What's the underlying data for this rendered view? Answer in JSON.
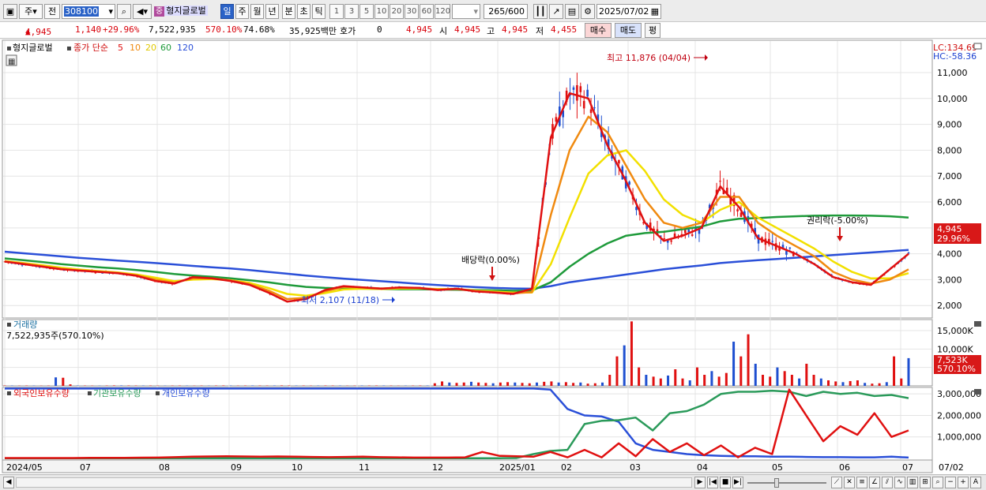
{
  "toolbar": {
    "menu_label": "주",
    "prev_label": "전",
    "stock_code": "308100",
    "stock_badge": "중",
    "stock_name": "형지글로벌",
    "periods": [
      "일",
      "주",
      "월",
      "년",
      "분",
      "초",
      "틱"
    ],
    "active_period": "일",
    "intervals": [
      "1",
      "3",
      "5",
      "10",
      "20",
      "30",
      "60",
      "120"
    ],
    "count_value": "265",
    "count_max": "/600",
    "date_value": "2025/07/02"
  },
  "quote": {
    "price": "4,945",
    "change": "1,140",
    "change_pct": "+29.96%",
    "volume": "7,522,935",
    "volume_ratio": "570.10%",
    "turnover": "74.68%",
    "amount": "35,925백만",
    "hoga_label": "호가",
    "hoga_value": "0",
    "close_value": "4,945",
    "open_label": "시",
    "open_value": "4,945",
    "high_label": "고",
    "high_value": "4,945",
    "low_label": "저",
    "low_value": "4,455",
    "buy_label": "매수",
    "sell_label": "매도",
    "avg_label": "평"
  },
  "legend": {
    "name": "형지글로벌",
    "ma_title": "종가 단순",
    "ma_periods": [
      "5",
      "10",
      "20",
      "60",
      "120"
    ],
    "lc": "LC:134.69",
    "hc": "HC:-58.36",
    "volume_title": "거래량",
    "volume_value": "7,522,935주(570.10%)",
    "holdings": [
      "외국인보유수량",
      "기관보유수량",
      "개인보유수량"
    ]
  },
  "annotations": {
    "high": "최고 11,876 (04/04)",
    "low": "최저 2,107 (11/18)",
    "dividend": "배당락(0.00%)",
    "rights": "권리락(-5.00%)",
    "price_tag": "4,945",
    "price_pct_tag": "29.96%",
    "vol_tag": "7,523K",
    "vol_pct_tag": "570.10%"
  },
  "colors": {
    "ma5": "#e01010",
    "ma10": "#f08a10",
    "ma20": "#f2e000",
    "ma60": "#1e9a3a",
    "ma120": "#2a4fd8",
    "up": "#e01010",
    "down": "#1e4fd0",
    "foreign": "#e01010",
    "institution": "#2a9a5a",
    "individual": "#2a4fd8"
  },
  "chart_data": [
    {
      "type": "candlestick",
      "title": "형지글로벌",
      "y_ticks": [
        "11,000",
        "10,000",
        "9,000",
        "8,000",
        "7,000",
        "6,000",
        "5,000",
        "4,000",
        "3,000",
        "2,000"
      ],
      "ylim": [
        1550,
        12250
      ],
      "x_ticks": [
        "2024/05",
        "07",
        "08",
        "09",
        "10",
        "11",
        "12",
        "2025/01",
        "02",
        "03",
        "04",
        "05",
        "06",
        "07",
        "07/02"
      ],
      "series": [
        {
          "name": "5",
          "values": [
            3700,
            3600,
            3500,
            3400,
            3350,
            3300,
            3250,
            3150,
            2950,
            2850,
            3100,
            3050,
            2950,
            2800,
            2500,
            2150,
            2250,
            2600,
            2750,
            2700,
            2650,
            2700,
            2680,
            2600,
            2650,
            2550,
            2500,
            2450,
            2650,
            8500,
            10200,
            10000,
            8200,
            6800,
            5200,
            4500,
            4700,
            5000,
            6600,
            5800,
            4600,
            4300,
            4000,
            3600,
            3100,
            2900,
            2800,
            3400,
            4000
          ]
        },
        {
          "name": "10",
          "values": [
            3700,
            3620,
            3520,
            3420,
            3360,
            3310,
            3260,
            3170,
            3000,
            2880,
            3050,
            3050,
            2970,
            2830,
            2580,
            2250,
            2300,
            2550,
            2720,
            2700,
            2660,
            2690,
            2680,
            2620,
            2640,
            2560,
            2510,
            2470,
            2520,
            5500,
            8000,
            9300,
            8700,
            7400,
            6100,
            5200,
            5000,
            5200,
            6200,
            6200,
            5200,
            4700,
            4300,
            3900,
            3300,
            3000,
            2850,
            3000,
            3400
          ]
        },
        {
          "name": "20",
          "values": [
            3720,
            3640,
            3560,
            3460,
            3390,
            3330,
            3280,
            3200,
            3080,
            2940,
            3000,
            3020,
            2980,
            2880,
            2680,
            2450,
            2380,
            2480,
            2620,
            2650,
            2640,
            2660,
            2660,
            2640,
            2640,
            2580,
            2540,
            2500,
            2500,
            3600,
            5400,
            7100,
            7800,
            8000,
            7200,
            6100,
            5500,
            5200,
            5700,
            6000,
            5400,
            5000,
            4600,
            4200,
            3700,
            3300,
            3050,
            3050,
            3250
          ]
        },
        {
          "name": "60",
          "values": [
            3820,
            3750,
            3680,
            3600,
            3540,
            3480,
            3430,
            3370,
            3300,
            3220,
            3160,
            3110,
            3050,
            2980,
            2900,
            2800,
            2720,
            2680,
            2660,
            2650,
            2640,
            2630,
            2630,
            2620,
            2610,
            2600,
            2590,
            2570,
            2580,
            2900,
            3500,
            4000,
            4400,
            4700,
            4800,
            4850,
            4950,
            5050,
            5250,
            5350,
            5380,
            5420,
            5450,
            5470,
            5480,
            5480,
            5470,
            5450,
            5400
          ]
        },
        {
          "name": "120",
          "values": [
            4080,
            4020,
            3960,
            3900,
            3840,
            3790,
            3740,
            3690,
            3640,
            3590,
            3530,
            3480,
            3430,
            3370,
            3300,
            3230,
            3160,
            3100,
            3040,
            2990,
            2940,
            2890,
            2840,
            2790,
            2750,
            2710,
            2680,
            2660,
            2650,
            2750,
            2900,
            3000,
            3100,
            3200,
            3300,
            3400,
            3480,
            3550,
            3640,
            3700,
            3750,
            3800,
            3850,
            3900,
            3950,
            4000,
            4050,
            4100,
            4150
          ]
        }
      ]
    },
    {
      "type": "bar",
      "title": "거래량",
      "y_ticks": [
        "15,000K",
        "10,000K",
        "5,000K"
      ],
      "ylim": [
        0,
        18000
      ],
      "values": [
        100,
        80,
        60,
        90,
        70,
        60,
        80,
        2300,
        2200,
        400,
        90,
        80,
        70,
        60,
        90,
        120,
        110,
        100,
        90,
        80,
        90,
        70,
        60,
        80,
        90,
        70,
        60,
        80,
        60,
        90,
        110,
        80,
        70,
        90,
        100,
        90,
        80,
        90,
        120,
        100,
        80,
        90,
        70,
        80,
        100,
        90,
        80,
        60,
        70,
        90,
        80,
        100,
        90,
        80,
        60,
        70,
        80,
        100,
        90,
        700,
        1200,
        900,
        800,
        900,
        1100,
        900,
        800,
        700,
        900,
        1000,
        900,
        800,
        700,
        900,
        1100,
        1200,
        900,
        1000,
        800,
        900,
        600,
        700,
        900,
        3000,
        8000,
        11000,
        17500,
        5000,
        3000,
        2500,
        2000,
        2800,
        4500,
        2000,
        1500,
        5000,
        3000,
        4000,
        2500,
        3500,
        12000,
        8000,
        14000,
        6000,
        3000,
        2500,
        5000,
        4000,
        3000,
        2000,
        6000,
        3000,
        2000,
        1500,
        1200,
        1000,
        1300,
        1500,
        800,
        600,
        700,
        1000,
        8000,
        2000,
        7523
      ]
    },
    {
      "type": "line",
      "title": "보유수량",
      "y_ticks": [
        "3,000,000",
        "2,000,000",
        "1,000,000"
      ],
      "ylim": [
        0,
        3300000
      ],
      "series": [
        {
          "name": "외국인보유수량",
          "values": [
            20000,
            20000,
            20000,
            20000,
            20000,
            30000,
            30000,
            30000,
            35000,
            40000,
            60000,
            80000,
            90000,
            100000,
            90000,
            80000,
            90000,
            80000,
            70000,
            60000,
            70000,
            80000,
            60000,
            50000,
            40000,
            40000,
            40000,
            50000,
            300000,
            120000,
            100000,
            80000,
            300000,
            50000,
            400000,
            50000,
            700000,
            100000,
            900000,
            300000,
            700000,
            150000,
            600000,
            50000,
            500000,
            200000,
            3200000,
            2000000,
            800000,
            1500000,
            1100000,
            2100000,
            1000000,
            1300000
          ]
        },
        {
          "name": "기관보유수량",
          "values": [
            10000,
            10000,
            10000,
            10000,
            10000,
            10000,
            10000,
            10000,
            10000,
            10000,
            10000,
            10000,
            10000,
            10000,
            10000,
            10000,
            10000,
            10000,
            10000,
            10000,
            10000,
            10000,
            10000,
            10000,
            10000,
            10000,
            10000,
            10000,
            10000,
            10000,
            20000,
            200000,
            350000,
            400000,
            1600000,
            1750000,
            1780000,
            1900000,
            1300000,
            2100000,
            2200000,
            2500000,
            3000000,
            3100000,
            3100000,
            3150000,
            3100000,
            2900000,
            3100000,
            3000000,
            3050000,
            2900000,
            2950000,
            2800000
          ]
        },
        {
          "name": "개인보유수량",
          "values": [
            3250000,
            3250000,
            3250000,
            3250000,
            3250000,
            3250000,
            3250000,
            3250000,
            3250000,
            3250000,
            3250000,
            3250000,
            3250000,
            3250000,
            3250000,
            3250000,
            3250000,
            3250000,
            3250000,
            3250000,
            3250000,
            3250000,
            3250000,
            3250000,
            3250000,
            3250000,
            3250000,
            3250000,
            3250000,
            3250000,
            3250000,
            3250000,
            3200000,
            2300000,
            2000000,
            1950000,
            1700000,
            700000,
            400000,
            300000,
            200000,
            150000,
            120000,
            100000,
            100000,
            80000,
            80000,
            70000,
            60000,
            60000,
            50000,
            50000,
            80000,
            40000
          ]
        }
      ]
    }
  ]
}
